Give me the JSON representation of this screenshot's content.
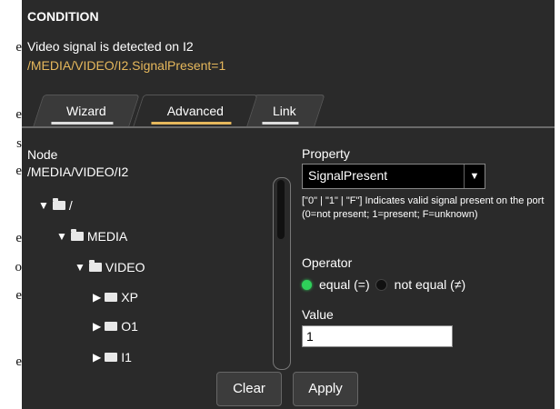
{
  "background_letters": [
    {
      "text": "e"
    },
    {
      "text": "e"
    },
    {
      "text": "s"
    },
    {
      "text": "e"
    },
    {
      "text": "e"
    },
    {
      "text": "o"
    },
    {
      "text": "e"
    },
    {
      "text": "e"
    }
  ],
  "condition": {
    "title": "CONDITION",
    "description": "Video signal is detected on I2",
    "path": "/MEDIA/VIDEO/I2.SignalPresent=1"
  },
  "tabs": [
    {
      "label": "Wizard",
      "active": false
    },
    {
      "label": "Advanced",
      "active": true
    },
    {
      "label": "Link",
      "active": false
    }
  ],
  "node": {
    "label": "Node",
    "path": "/MEDIA/VIDEO/I2",
    "tree": [
      {
        "label": "/",
        "expanded": true
      },
      {
        "label": "MEDIA",
        "expanded": true
      },
      {
        "label": "VIDEO",
        "expanded": true
      },
      {
        "label": "XP",
        "expanded": false
      },
      {
        "label": "O1",
        "expanded": false
      },
      {
        "label": "I1",
        "expanded": false
      }
    ]
  },
  "property": {
    "label": "Property",
    "selected": "SignalPresent",
    "description": "[\"0\" | \"1\" | \"F\"] Indicates valid signal present on the port (0=not present; 1=present; F=unknown)"
  },
  "operator": {
    "label": "Operator",
    "options": [
      "equal (=)",
      "not equal (≠)"
    ],
    "selected": "equal (=)"
  },
  "value": {
    "label": "Value",
    "current": "1"
  },
  "buttons": {
    "clear": "Clear",
    "apply": "Apply"
  },
  "colors": {
    "panel_bg": "#2a2a2a",
    "accent": "#e6b85c",
    "radio_on": "#2fd05a"
  }
}
